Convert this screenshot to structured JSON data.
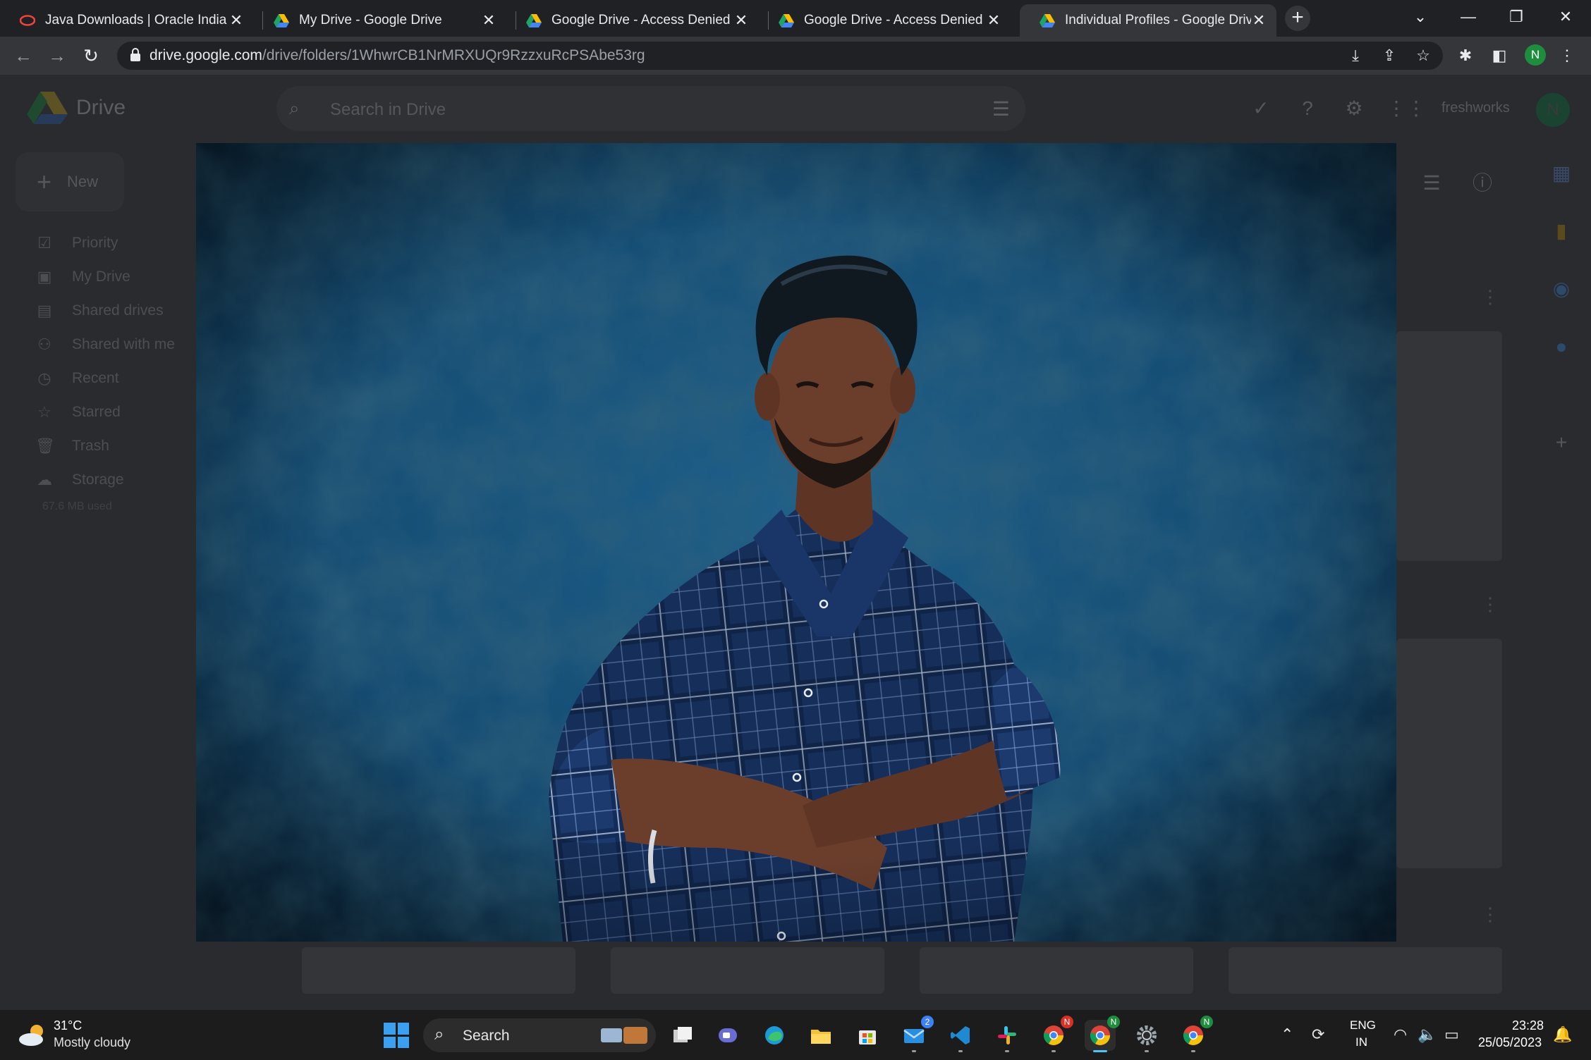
{
  "browser": {
    "tabs": [
      {
        "title": "Java Downloads | Oracle India",
        "favicon": "oracle-icon",
        "active": false
      },
      {
        "title": "My Drive - Google Drive",
        "favicon": "google-drive-icon",
        "active": false
      },
      {
        "title": "Google Drive - Access Denied",
        "favicon": "google-drive-icon",
        "active": false
      },
      {
        "title": "Google Drive - Access Denied",
        "favicon": "google-drive-icon",
        "active": false
      },
      {
        "title": "Individual Profiles - Google Drive",
        "favicon": "google-drive-icon",
        "active": true
      }
    ],
    "close_glyph": "✕",
    "new_tab_glyph": "+",
    "url_host": "drive.google.com",
    "url_path": "/drive/folders/1WhwrCB1NrMRXUQr9RzzxuRcPSAbe53rg",
    "profile_initial": "N"
  },
  "drive": {
    "title": "Drive",
    "search_placeholder": "Search in Drive",
    "org_label": "freshworks",
    "avatar_initial": "N",
    "new_button_label": "New",
    "nav": [
      {
        "label": "Priority",
        "icon": "priority-icon"
      },
      {
        "label": "My Drive",
        "icon": "my-drive-icon"
      },
      {
        "label": "Shared drives",
        "icon": "shared-drives-icon"
      },
      {
        "label": "Shared with me",
        "icon": "shared-with-me-icon"
      },
      {
        "label": "Recent",
        "icon": "clock-icon"
      },
      {
        "label": "Starred",
        "icon": "star-icon"
      },
      {
        "label": "Trash",
        "icon": "trash-icon"
      },
      {
        "label": "Storage",
        "icon": "cloud-icon"
      }
    ],
    "storage_used": "67.6 MB used"
  },
  "viewer": {
    "image_subject": "Portrait of a young man in a blue checked shirt with arms crossed against a blue textured backdrop",
    "colors": {
      "backdrop": "#1d5f8a",
      "backdrop_dark": "#0b2236",
      "shirt": "#1c3a6e",
      "skin": "#6b3e2c",
      "hair": "#101820"
    }
  },
  "taskbar": {
    "weather_temp": "31°C",
    "weather_desc": "Mostly cloudy",
    "search_label": "Search",
    "chat_badge": "2",
    "lang_top": "ENG",
    "lang_bottom": "IN",
    "time": "23:28",
    "date": "25/05/2023"
  }
}
